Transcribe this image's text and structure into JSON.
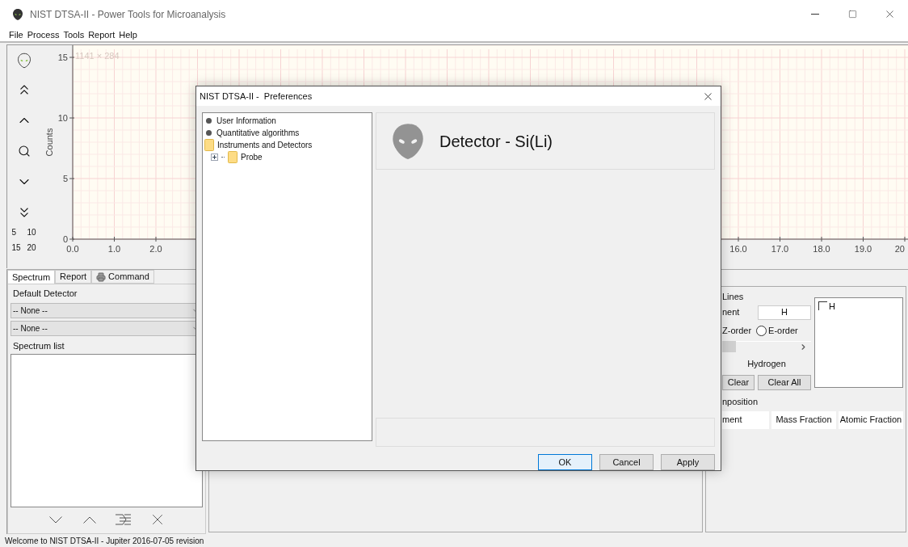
{
  "window": {
    "title": "NIST DTSA-II - Power Tools for Microanalysis"
  },
  "menu": [
    "File",
    "Process",
    "Tools",
    "Report",
    "Help"
  ],
  "toolbar": {
    "scale_buttons": [
      "5",
      "10",
      "15",
      "20"
    ]
  },
  "plot": {
    "size_label": "1141 × 284",
    "chart_data": {
      "type": "line",
      "ylabel": "Counts",
      "xlim": [
        0,
        20
      ],
      "ylim": [
        0,
        15
      ],
      "xticks": [
        {
          "value": 0,
          "label": "0.0"
        },
        {
          "value": 1,
          "label": "1.0"
        },
        {
          "value": 2,
          "label": "2.0"
        },
        {
          "value": 16,
          "label": "16.0"
        },
        {
          "value": 17,
          "label": "17.0"
        },
        {
          "value": 18,
          "label": "18.0"
        },
        {
          "value": 19,
          "label": "19.0"
        },
        {
          "value": 20,
          "label": "20"
        }
      ],
      "yticks": [
        0,
        5,
        10,
        15
      ],
      "grid": true
    }
  },
  "left_panel": {
    "tabs": [
      {
        "label": "Spectrum",
        "selected": true
      },
      {
        "label": "Report",
        "selected": false
      },
      {
        "label": "Command",
        "selected": false,
        "kind": "printer"
      }
    ],
    "detector_group": "Default Detector",
    "detector_selects": [
      "-- None --",
      "-- None --"
    ],
    "list_group": "Spectrum list"
  },
  "right_panel": {
    "lines_group": "Lines",
    "element_label": "nent",
    "element_value": "H",
    "z_order_label": "Z-order",
    "e_order": {
      "label": "E-order",
      "selected": false
    },
    "element_slider": {
      "level": 0
    },
    "element_name": "Hydrogen",
    "buttons": [
      "Clear",
      "Clear All"
    ],
    "element_list": [
      {
        "label": "H",
        "checked": false
      }
    ],
    "composition_group": "nposition",
    "composition_columns": [
      "ment",
      "Mass Fraction",
      "Atomic Fraction"
    ]
  },
  "dialog": {
    "title": "NIST DTSA-II -  Preferences",
    "tree": [
      {
        "label": "User Information",
        "kind": "leaf"
      },
      {
        "label": "Quantitative algorithms",
        "kind": "leaf"
      },
      {
        "label": "Instruments and Detectors",
        "kind": "folder",
        "children": [
          {
            "label": "Probe",
            "kind": "folder",
            "expanded": false
          }
        ]
      }
    ],
    "heading": "Detector - Si(Li)",
    "buttons": [
      {
        "label": "OK",
        "default": true
      },
      {
        "label": "Cancel",
        "default": false
      },
      {
        "label": "Apply",
        "default": false
      }
    ]
  },
  "status_bar": "Welcome to NIST DTSA-II - Jupiter 2016-07-05 revision"
}
